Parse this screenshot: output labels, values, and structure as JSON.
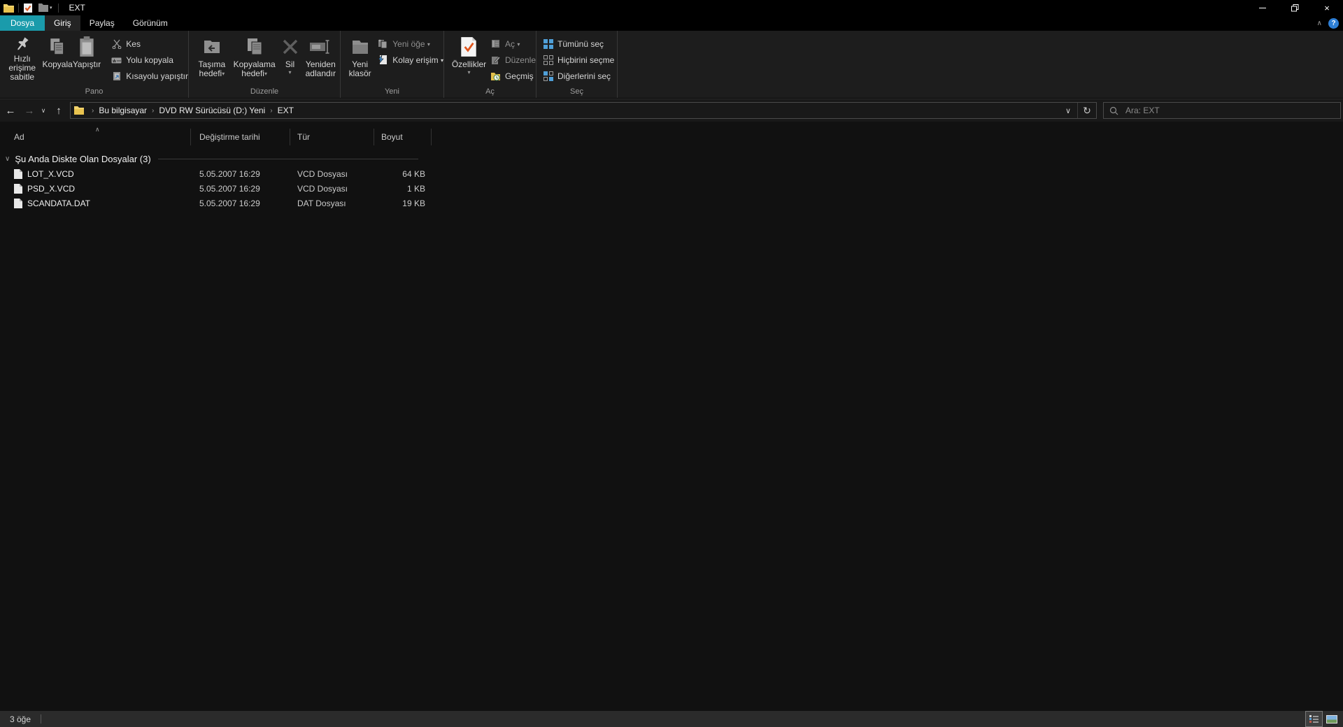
{
  "titlebar": {
    "title": "EXT"
  },
  "glyphs": {
    "back": "←",
    "forward": "→",
    "up": "↑",
    "chevron_down": "∨",
    "chevron_up": "∧",
    "refresh": "↻",
    "crumb_sep": "›",
    "caret": "▾",
    "close": "×",
    "help": "?"
  },
  "tabs": {
    "file": "Dosya",
    "home": "Giriş",
    "share": "Paylaş",
    "view": "Görünüm"
  },
  "ribbon": {
    "pano": {
      "label": "Pano",
      "pin": "Hızlı erişime sabitle",
      "copy": "Kopyala",
      "paste": "Yapıştır",
      "cut": "Kes",
      "copy_path": "Yolu kopyala",
      "paste_shortcut": "Kısayolu yapıştır"
    },
    "duzenle": {
      "label": "Düzenle",
      "move_to": "Taşıma hedefi",
      "copy_to": "Kopyalama hedefi",
      "delete": "Sil",
      "rename": "Yeniden adlandır"
    },
    "yeni": {
      "label": "Yeni",
      "new_folder": "Yeni klasör",
      "new_item": "Yeni öğe",
      "easy_access": "Kolay erişim"
    },
    "ac": {
      "label": "Aç",
      "properties": "Özellikler",
      "open": "Aç",
      "edit": "Düzenle",
      "history": "Geçmiş"
    },
    "sec": {
      "label": "Seç",
      "select_all": "Tümünü seç",
      "select_none": "Hiçbirini seçme",
      "invert": "Diğerlerini seç"
    }
  },
  "navbar": {
    "breadcrumb": {
      "0": "Bu bilgisayar",
      "1": "DVD RW Sürücüsü (D:) Yeni",
      "2": "EXT"
    },
    "search_placeholder": "Ara: EXT"
  },
  "columns": {
    "name": "Ad",
    "date": "Değiştirme tarihi",
    "type": "Tür",
    "size": "Boyut"
  },
  "listing": {
    "group": "Şu Anda Diskte Olan Dosyalar (3)",
    "files": [
      {
        "name": "LOT_X.VCD",
        "date": "5.05.2007 16:29",
        "type": "VCD Dosyası",
        "size": "64 KB"
      },
      {
        "name": "PSD_X.VCD",
        "date": "5.05.2007 16:29",
        "type": "VCD Dosyası",
        "size": "1 KB"
      },
      {
        "name": "SCANDATA.DAT",
        "date": "5.05.2007 16:29",
        "type": "DAT Dosyası",
        "size": "19 KB"
      }
    ]
  },
  "statusbar": {
    "item_count": "3 öğe"
  },
  "colors": {
    "accent_teal": "#1a9bab",
    "help_blue": "#2e7fd6",
    "selection_blue": "#4f9fd8",
    "check_orange": "#e0561e",
    "folder_yellow": "#e9c34f"
  }
}
